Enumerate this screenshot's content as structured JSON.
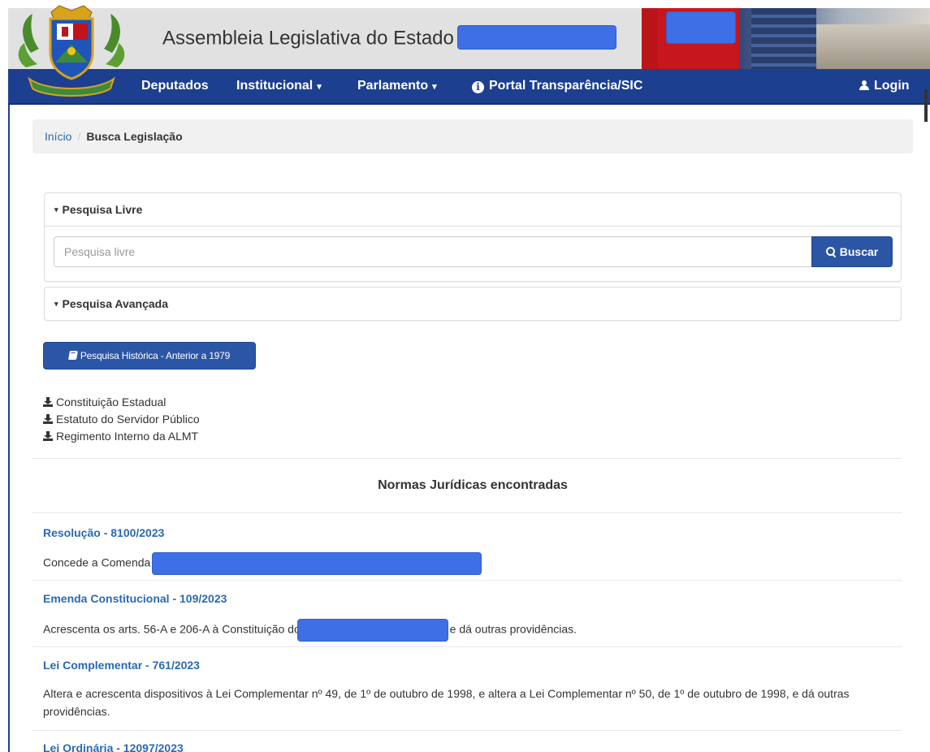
{
  "header": {
    "title": "Assembleia Legislativa do Estado"
  },
  "nav": {
    "items": [
      {
        "label": "Deputados",
        "dropdown": false
      },
      {
        "label": "Institucional",
        "dropdown": true
      },
      {
        "label": "Parlamento",
        "dropdown": true
      },
      {
        "label": "Portal Transparência/SIC",
        "icon": "info-icon"
      }
    ],
    "login": "Login",
    "caret": "▾"
  },
  "breadcrumb": {
    "home": "Início",
    "separator": "/",
    "current": "Busca Legislação"
  },
  "search": {
    "free_heading": "Pesquisa Livre",
    "placeholder": "Pesquisa livre",
    "value": "",
    "button": "Buscar",
    "advanced_heading": "Pesquisa Avançada",
    "heading_caret": "▾"
  },
  "historic_button": "Pesquisa Histórica - Anterior a 1979",
  "downloads": [
    "Constituição Estadual",
    "Estatuto do Servidor Público",
    "Regimento Interno da ALMT"
  ],
  "results": {
    "title": "Normas Jurídicas encontradas",
    "items": [
      {
        "title": "Resolução - 8100/2023",
        "desc_before": "Concede a Comenda",
        "desc_after": ""
      },
      {
        "title": "Emenda Constitucional - 109/2023",
        "desc_before": "Acrescenta os arts. 56-A e 206-A à Constituição do",
        "desc_after": "e dá outras providências."
      },
      {
        "title": "Lei Complementar - 761/2023",
        "desc_before": "Altera e acrescenta dispositivos à Lei Complementar nº 49, de 1º de outubro de 1998, e altera a Lei Complementar nº 50, de 1º de outubro de 1998, e dá outras providências.",
        "desc_after": ""
      },
      {
        "title": "Lei Ordinária - 12097/2023",
        "desc_before": "",
        "desc_after": ""
      }
    ]
  },
  "colors": {
    "navbar": "#1d3f8f",
    "link": "#2a6ab1",
    "button": "#2b55a5",
    "redaction": "#3f6fe6"
  }
}
